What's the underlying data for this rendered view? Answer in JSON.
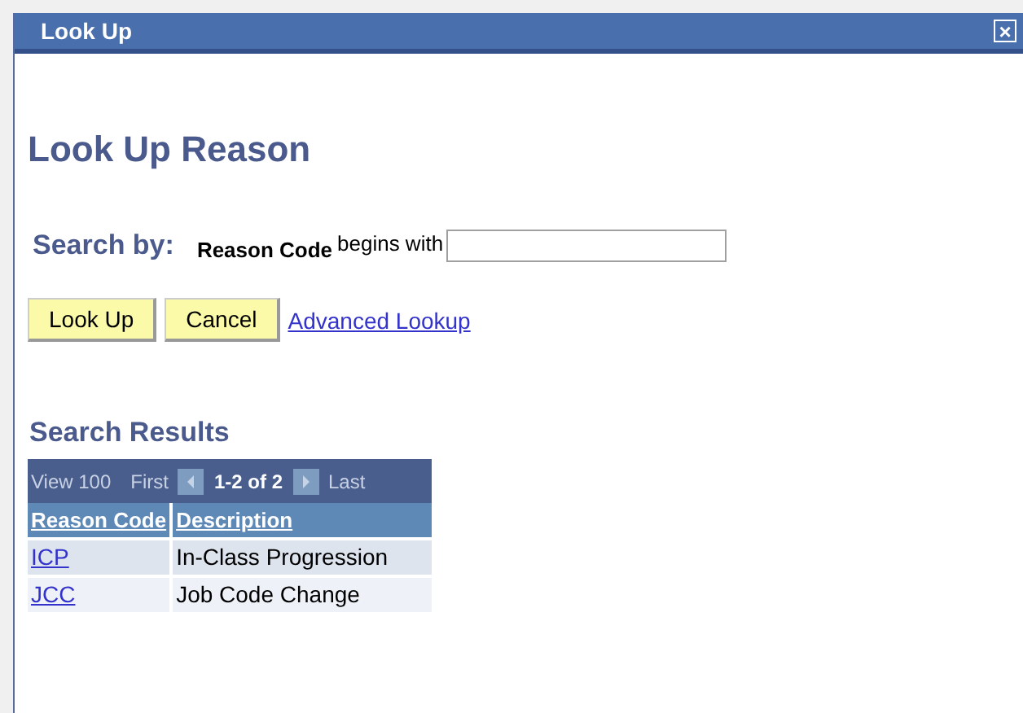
{
  "window": {
    "title": "Look Up",
    "close": "×"
  },
  "heading": "Look Up Reason",
  "search": {
    "label": "Search by:",
    "field": "Reason Code",
    "operator": "begins with"
  },
  "buttons": [
    "Look Up",
    "Cancel"
  ],
  "advanced_link": "Advanced Lookup",
  "results": {
    "title": "Search Results",
    "nav": {
      "view": "View 100",
      "first": "First",
      "range": "1-2 of 2",
      "last": "Last"
    },
    "columns": [
      "Reason Code",
      "Description"
    ],
    "rows": [
      {
        "code": "ICP",
        "description": "In-Class Progression"
      },
      {
        "code": "JCC",
        "description": "Job Code Change"
      }
    ]
  }
}
